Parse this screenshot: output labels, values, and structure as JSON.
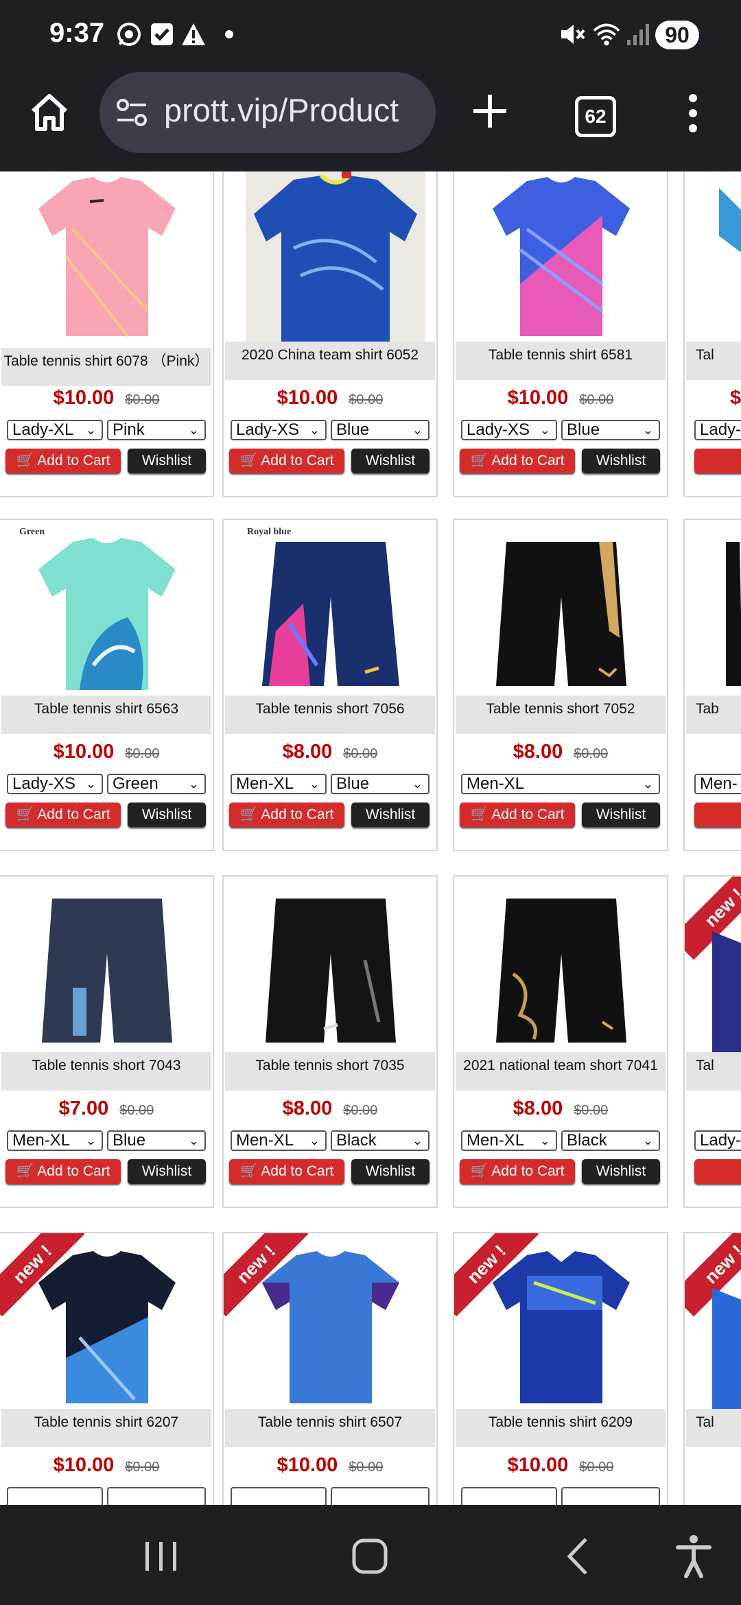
{
  "status": {
    "time": "9:37",
    "battery": "90"
  },
  "browser": {
    "url": "prott.vip/Product",
    "tab_count": "62"
  },
  "labels": {
    "add_to_cart": "Add to Cart",
    "wishlist": "Wishlist",
    "new_badge": "new !"
  },
  "products": [
    {
      "name": "Table tennis shirt 6078 （Pink）",
      "price": "$10.00",
      "old_price": "$0.00",
      "size": "Lady-XL",
      "color": "Pink"
    },
    {
      "name": "2020 China team shirt 6052",
      "price": "$10.00",
      "old_price": "$0.00",
      "size": "Lady-XS",
      "color": "Blue"
    },
    {
      "name": "Table tennis shirt 6581",
      "price": "$10.00",
      "old_price": "$0.00",
      "size": "Lady-XS",
      "color": "Blue"
    },
    {
      "name": "Tal",
      "price": "$",
      "size": "Lady-"
    },
    {
      "name": "Table tennis shirt 6563",
      "price": "$10.00",
      "old_price": "$0.00",
      "size": "Lady-XS",
      "color": "Green",
      "image_tag": "Green"
    },
    {
      "name": "Table tennis short 7056",
      "price": "$8.00",
      "old_price": "$0.00",
      "size": "Men-XL",
      "color": "Blue",
      "image_tag": "Royal blue"
    },
    {
      "name": "Table tennis short 7052",
      "price": "$8.00",
      "old_price": "$0.00",
      "size": "Men-XL"
    },
    {
      "name": "Tab",
      "size": "Men-"
    },
    {
      "name": "Table tennis short 7043",
      "price": "$7.00",
      "old_price": "$0.00",
      "size": "Men-XL",
      "color": "Blue"
    },
    {
      "name": "Table tennis short 7035",
      "price": "$8.00",
      "old_price": "$0.00",
      "size": "Men-XL",
      "color": "Black"
    },
    {
      "name": "2021 national team short 7041",
      "price": "$8.00",
      "old_price": "$0.00",
      "size": "Men-XL",
      "color": "Black"
    },
    {
      "name": "Tal",
      "size": "Lady-"
    },
    {
      "name": "Table tennis shirt 6207",
      "price": "$10.00",
      "old_price": "$0.00"
    },
    {
      "name": "Table tennis shirt 6507",
      "price": "$10.00",
      "old_price": "$0.00"
    },
    {
      "name": "Table tennis shirt 6209",
      "price": "$10.00",
      "old_price": "$0.00"
    },
    {
      "name": "Tal"
    }
  ],
  "colors": {
    "price_red": "#c00000",
    "cart_red": "#d62b2b",
    "dark_bar": "#1d1f24"
  },
  "icons": {
    "status": [
      "whatsapp-icon",
      "check-icon",
      "warning-icon",
      "dot-icon",
      "mute-icon",
      "wifi-icon",
      "signal-icon"
    ],
    "browser": [
      "home-icon",
      "site-settings-icon",
      "plus-icon",
      "menu-icon"
    ],
    "nav": [
      "recents-icon",
      "home-icon",
      "back-icon",
      "accessibility-icon"
    ]
  }
}
